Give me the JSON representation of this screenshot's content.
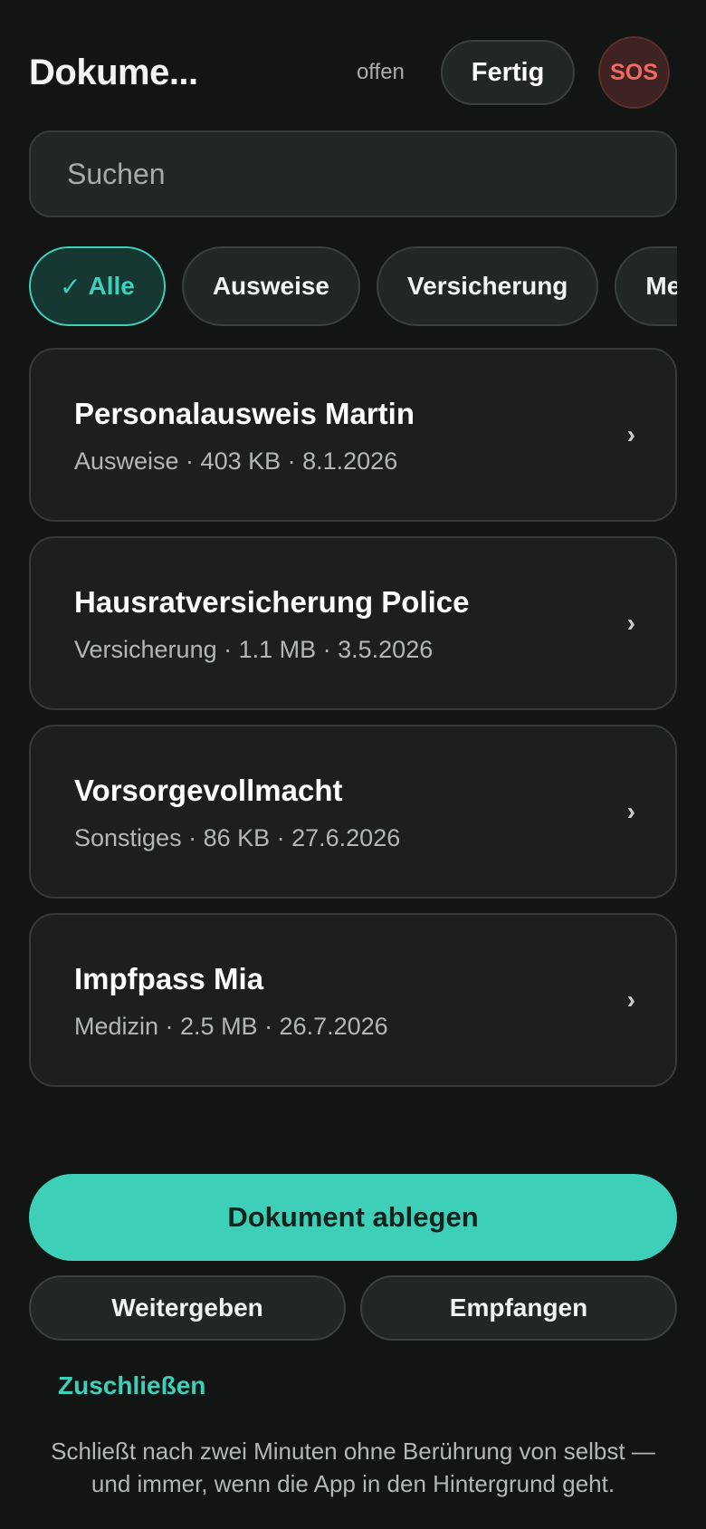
{
  "header": {
    "title": "Dokume...",
    "status": "offen",
    "done_label": "Fertig",
    "sos_label": "SOS"
  },
  "search": {
    "placeholder": "Suchen",
    "value": ""
  },
  "filters": [
    {
      "check": "✓",
      "label": "Alle",
      "active": true
    },
    {
      "label": "Ausweise"
    },
    {
      "label": "Versicherung"
    },
    {
      "label": "Medizin"
    }
  ],
  "documents": [
    {
      "title": "Personalausweis Martin",
      "meta": "Ausweise · 403 KB · 8.1.2026",
      "chevron": "›"
    },
    {
      "title": "Hausratversicherung Police",
      "meta": "Versicherung · 1.1 MB · 3.5.2026",
      "chevron": "›"
    },
    {
      "title": "Vorsorgevollmacht",
      "meta": "Sonstiges · 86 KB · 27.6.2026",
      "chevron": "›"
    },
    {
      "title": "Impfpass Mia",
      "meta": "Medizin · 2.5 MB · 26.7.2026",
      "chevron": "›"
    }
  ],
  "actions": {
    "primary_label": "Dokument ablegen",
    "share_label": "Weitergeben",
    "receive_label": "Empfangen",
    "lock_label": "Zuschließen"
  },
  "hint": "Schließt nach zwei Minuten ohne Berührung von selbst — und immer, wenn die App in den Hintergrund geht.",
  "colors": {
    "background": "#121514",
    "accent": "#3ecfb8",
    "sos": "#ef6b63",
    "card": "#1c1f1e"
  }
}
